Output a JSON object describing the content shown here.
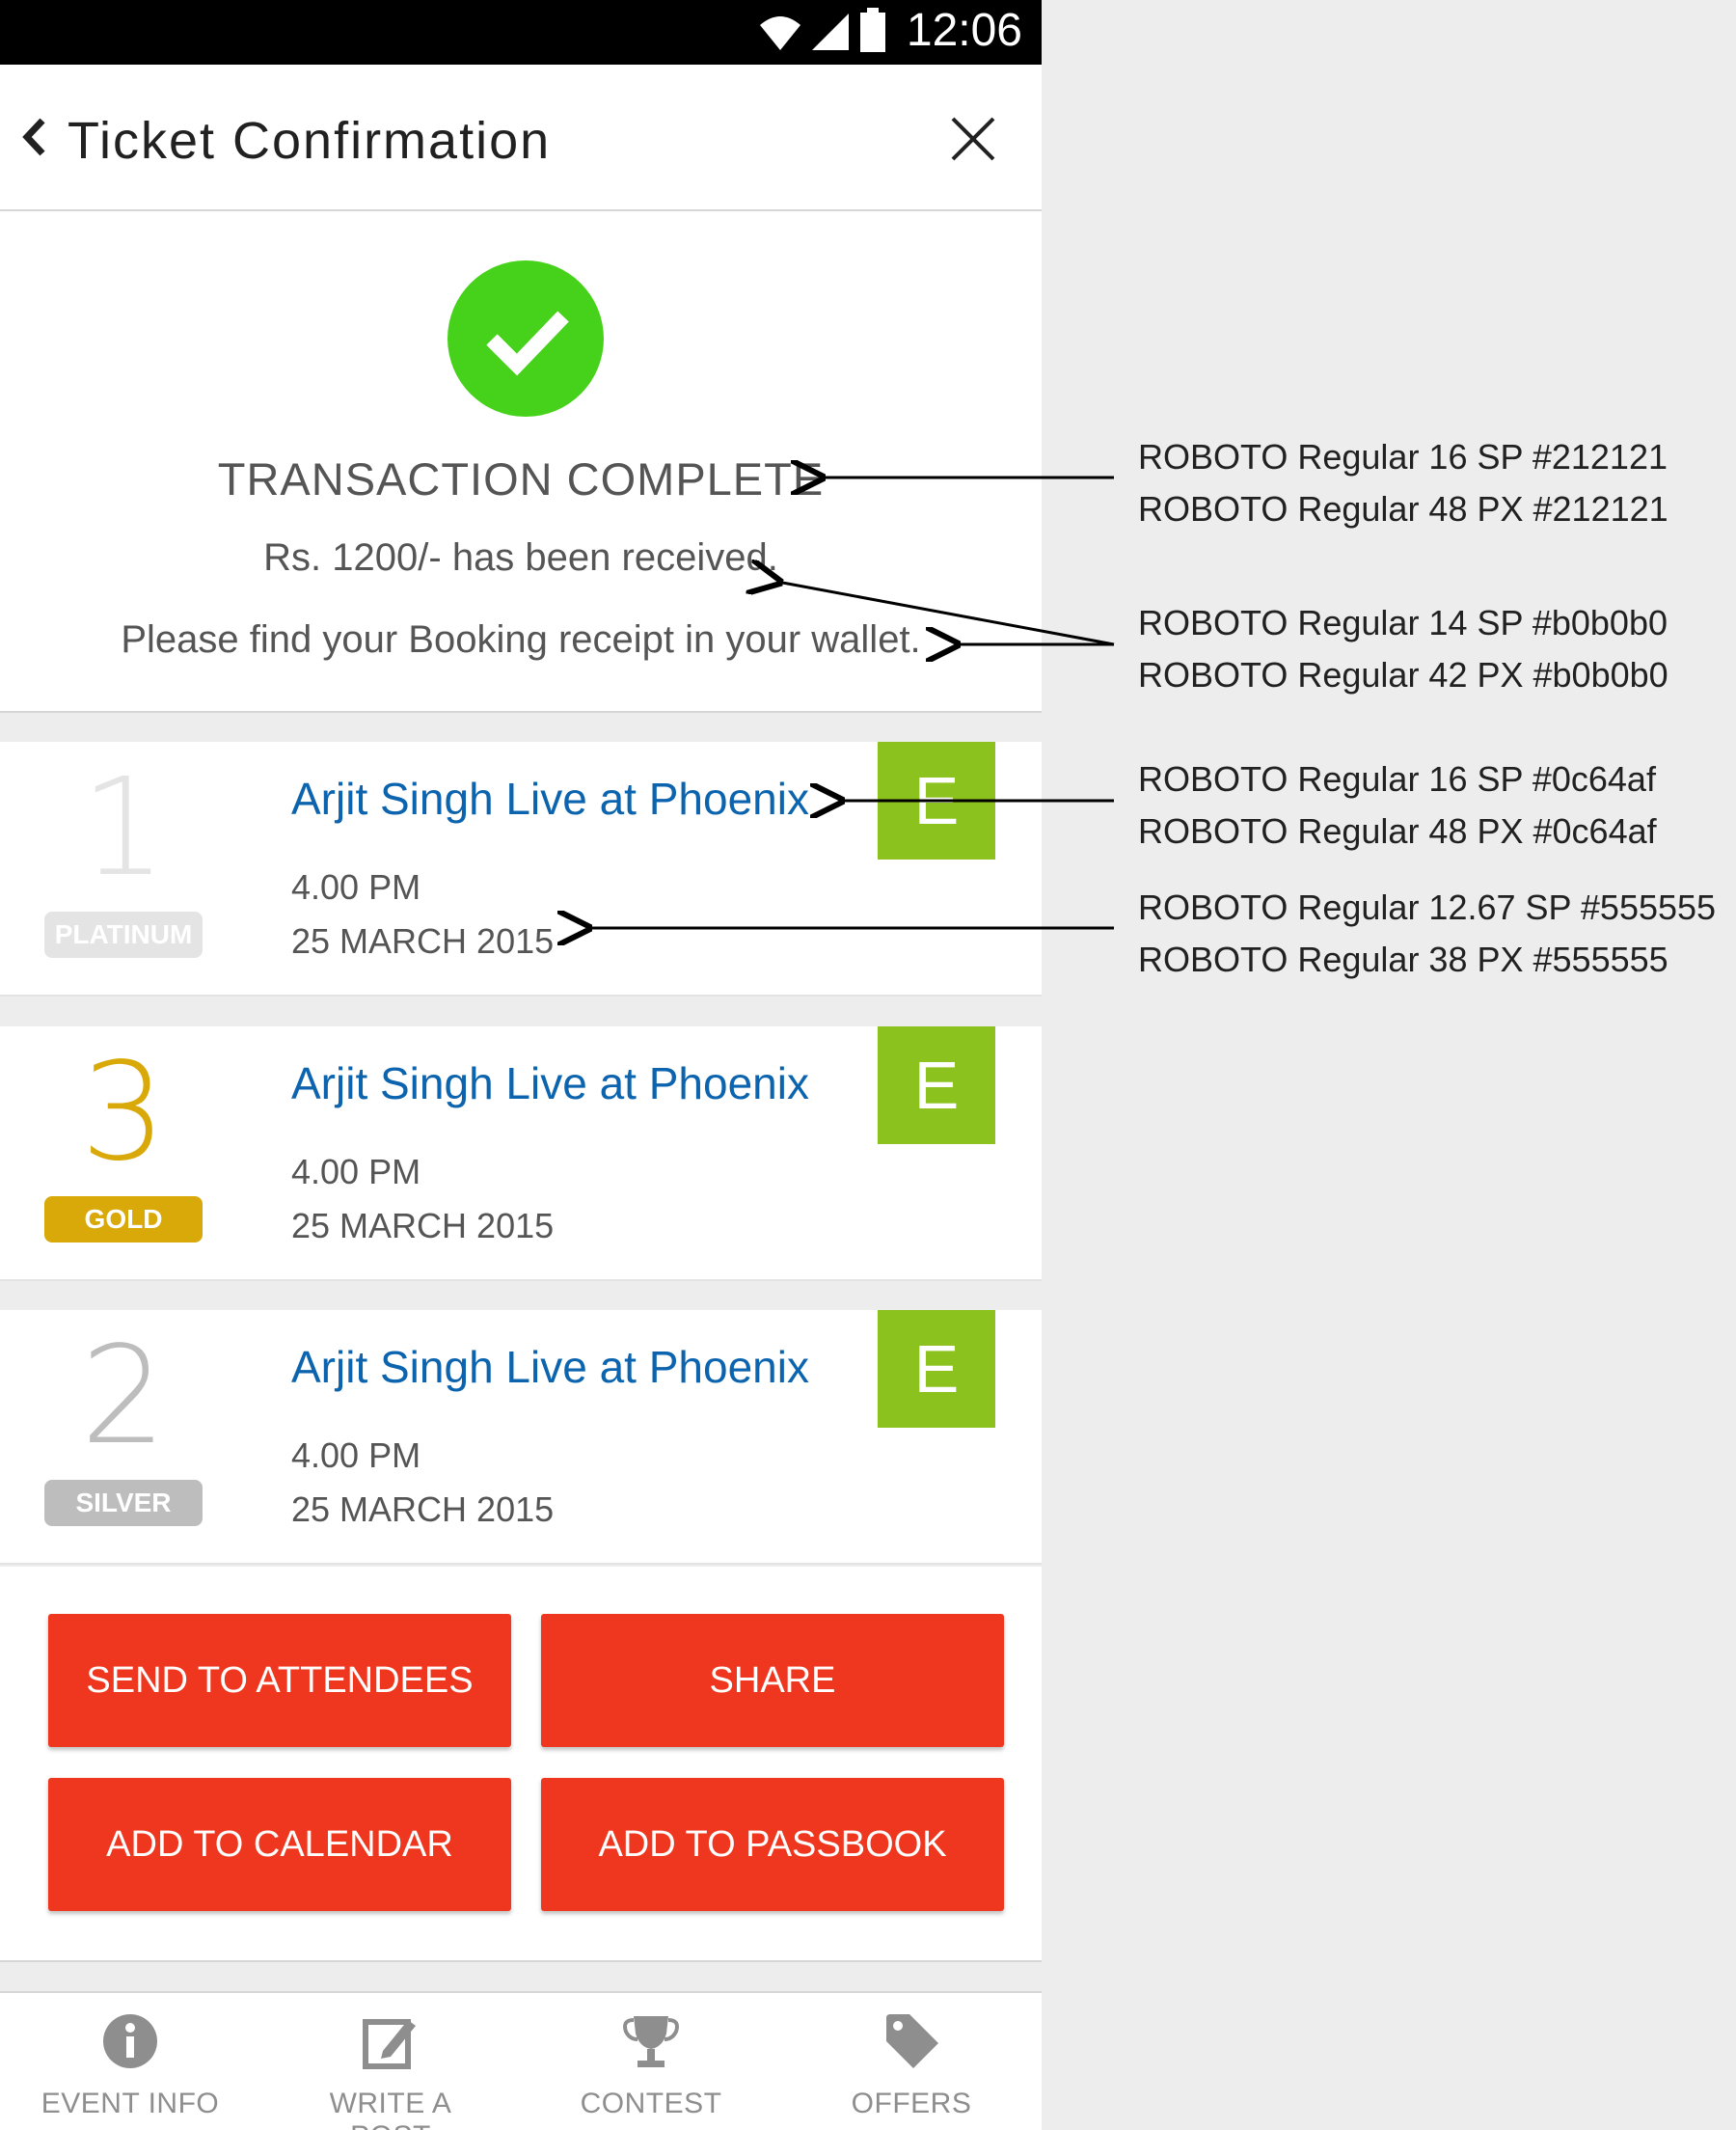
{
  "status_bar": {
    "time": "12:06"
  },
  "app_bar": {
    "title": "Ticket Confirmation"
  },
  "confirmation": {
    "heading": "TRANSACTION COMPLETE",
    "amount_line": "Rs. 1200/- has been received.",
    "receipt_line": "Please find your Booking receipt in your wallet."
  },
  "tickets": [
    {
      "quantity": "1",
      "tier": "PLATINUM",
      "event": "Arjit Singh Live at Phoenix",
      "time": "4.00 PM",
      "date": "25 MARCH 2015",
      "badge": "E",
      "qty_color": "#e4e4e4",
      "tier_color": "#e4e4e4"
    },
    {
      "quantity": "3",
      "tier": "GOLD",
      "event": "Arjit Singh Live at Phoenix",
      "time": "4.00 PM",
      "date": "25 MARCH 2015",
      "badge": "E",
      "qty_color": "#d9a90a",
      "tier_color": "#d9a90a"
    },
    {
      "quantity": "2",
      "tier": "SILVER",
      "event": "Arjit Singh Live at Phoenix",
      "time": "4.00 PM",
      "date": "25 MARCH 2015",
      "badge": "E",
      "qty_color": "#bdbdbd",
      "tier_color": "#bdbdbd"
    }
  ],
  "actions": {
    "send": "SEND TO ATTENDEES",
    "share": "SHARE",
    "calendar": "ADD TO CALENDAR",
    "passbook": "ADD TO PASSBOOK"
  },
  "bottom_nav": [
    {
      "label": "EVENT INFO",
      "icon": "info-icon"
    },
    {
      "label": "WRITE A POST",
      "icon": "edit-icon"
    },
    {
      "label": "CONTEST",
      "icon": "trophy-icon"
    },
    {
      "label": "OFFERS",
      "icon": "tag-icon"
    }
  ],
  "annotations": [
    {
      "line1": "ROBOTO Regular 16 SP #212121",
      "line2": "ROBOTO Regular 48 PX #212121"
    },
    {
      "line1": "ROBOTO Regular 14 SP #b0b0b0",
      "line2": "ROBOTO Regular 42 PX #b0b0b0"
    },
    {
      "line1": "ROBOTO Regular 16 SP #0c64af",
      "line2": "ROBOTO Regular 48 PX #0c64af"
    },
    {
      "line1": "ROBOTO Regular 12.67 SP #555555",
      "line2": "ROBOTO Regular 38 PX #555555"
    }
  ],
  "colors": {
    "accent_button": "#ef371f",
    "success": "#46d21a",
    "event_title": "#0c64af",
    "badge": "#8cc21e"
  }
}
